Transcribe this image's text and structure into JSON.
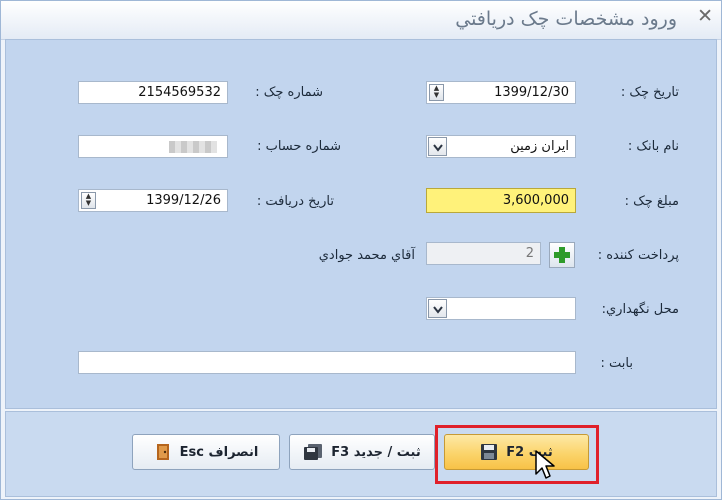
{
  "window": {
    "title": "ورود مشخصات چک دريافتي",
    "close_glyph": "✕"
  },
  "form": {
    "check_date": {
      "label": "تاريخ چک :",
      "value": "1399/12/30"
    },
    "check_number": {
      "label": "شماره چک :",
      "value": "2154569532"
    },
    "bank_name": {
      "label": "نام بانک :",
      "value": "ايران زمين"
    },
    "account_number": {
      "label": "شماره حساب :",
      "value": ""
    },
    "check_amount": {
      "label": "مبلغ چک :",
      "value": "3,600,000"
    },
    "receive_date": {
      "label": "تاريخ دريافت :",
      "value": "1399/12/26"
    },
    "payer": {
      "label": "پرداخت کننده :",
      "code": "2",
      "name": "آقاي محمد جوادي"
    },
    "storage_location": {
      "label": "محل نگهداري:",
      "value": ""
    },
    "regarding": {
      "label": "بابت :",
      "value": ""
    }
  },
  "buttons": {
    "save": {
      "label": "ثبت F2"
    },
    "save_new": {
      "label": "ثبت / جديد F3"
    },
    "cancel": {
      "label": "انصراف Esc"
    }
  },
  "colors": {
    "panel": "#c2d5ee",
    "amount_highlight": "#fff27a",
    "primary_button": "#fbd46b",
    "callout": "#e0202a"
  }
}
